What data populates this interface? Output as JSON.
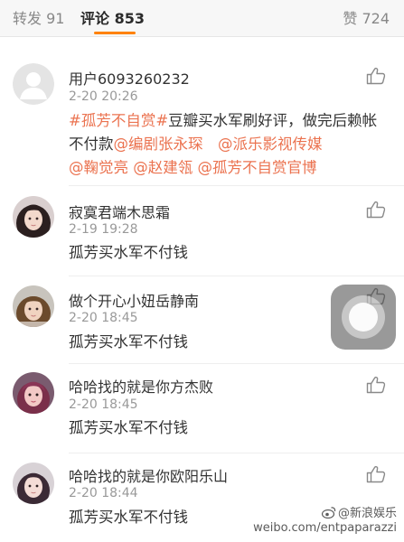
{
  "tabs": {
    "repost": {
      "label": "转发",
      "count": "91"
    },
    "comments": {
      "label": "评论",
      "count": "853"
    },
    "likes": {
      "label": "赞",
      "count": "724"
    }
  },
  "comments": [
    {
      "username": "用户6093260232",
      "time": "2-20 20:26",
      "body_parts": [
        {
          "text": "#孤芳不自赏#",
          "style": "tag"
        },
        {
          "text": "豆瓣买水军刷好评，做完后赖帐不付款",
          "style": "plain"
        },
        {
          "text": "@编剧张永琛",
          "style": "link"
        },
        {
          "text": "　",
          "style": "plain"
        },
        {
          "text": "@派乐影视传媒",
          "style": "link"
        },
        {
          "text": " ",
          "style": "plain"
        },
        {
          "text": "@鞠觉亮",
          "style": "link"
        },
        {
          "text": " ",
          "style": "plain"
        },
        {
          "text": "@赵建瓴",
          "style": "link"
        },
        {
          "text": " ",
          "style": "plain"
        },
        {
          "text": "@孤芳不自赏官博",
          "style": "link"
        }
      ],
      "avatar": "default-avatar"
    },
    {
      "username": "寂寞君端木思霜",
      "time": "2-19 19:28",
      "body": "孤芳买水军不付钱",
      "avatar": "girl-avatar-1"
    },
    {
      "username": "做个开心小妞岳静南",
      "time": "2-20 18:45",
      "body": "孤芳买水军不付钱",
      "avatar": "girl-avatar-2"
    },
    {
      "username": "哈哈找的就是你方杰败",
      "time": "2-20 18:45",
      "body": "孤芳买水军不付钱",
      "avatar": "girl-avatar-3"
    },
    {
      "username": "哈哈找的就是你欧阳乐山",
      "time": "2-20 18:44",
      "body": "孤芳买水军不付钱",
      "avatar": "girl-avatar-4"
    }
  ],
  "watermark": {
    "brand": "@新浪娱乐",
    "url": "weibo.com/entpaparazzi"
  },
  "icons": {
    "like": "thumbs-up-icon",
    "assistive": "assistive-touch-icon"
  },
  "colors": {
    "accent": "#ff8200",
    "link": "#eb7350",
    "text": "#333333",
    "muted": "#999999"
  }
}
